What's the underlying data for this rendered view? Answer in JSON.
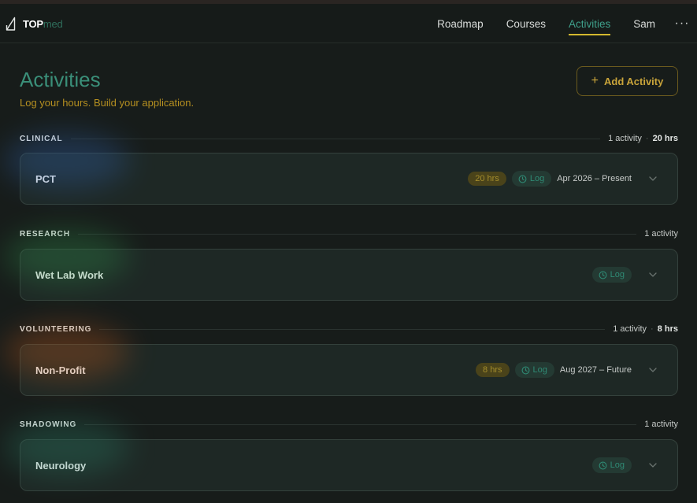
{
  "brand": {
    "part1": "TOP",
    "part2": "med"
  },
  "nav": {
    "items": [
      {
        "label": "Roadmap"
      },
      {
        "label": "Courses"
      },
      {
        "label": "Activities"
      },
      {
        "label": "Sam"
      }
    ],
    "active": "Activities",
    "more": "···"
  },
  "header": {
    "title": "Activities",
    "subtitle": "Log your hours. Build your application.",
    "add_button": "Add Activity"
  },
  "sections": [
    {
      "title": "CLINICAL",
      "count": "1 activity",
      "hours": "20 hrs",
      "activity": {
        "name": "PCT",
        "hours": "20 hrs",
        "log": "Log",
        "dates": "Apr 2026 – Present"
      }
    },
    {
      "title": "RESEARCH",
      "count": "1 activity",
      "hours": "",
      "activity": {
        "name": "Wet Lab Work",
        "hours": "",
        "log": "Log",
        "dates": ""
      }
    },
    {
      "title": "VOLUNTEERING",
      "count": "1 activity",
      "hours": "8 hrs",
      "activity": {
        "name": "Non-Profit",
        "hours": "8 hrs",
        "log": "Log",
        "dates": "Aug 2027 – Future"
      }
    },
    {
      "title": "SHADOWING",
      "count": "1 activity",
      "hours": "",
      "activity": {
        "name": "Neurology",
        "hours": "",
        "log": "Log",
        "dates": ""
      }
    }
  ],
  "colors": {
    "accent_teal": "#3fa08b",
    "accent_gold": "#d4b92e",
    "background": "#171c1a",
    "card": "#1e2825"
  }
}
